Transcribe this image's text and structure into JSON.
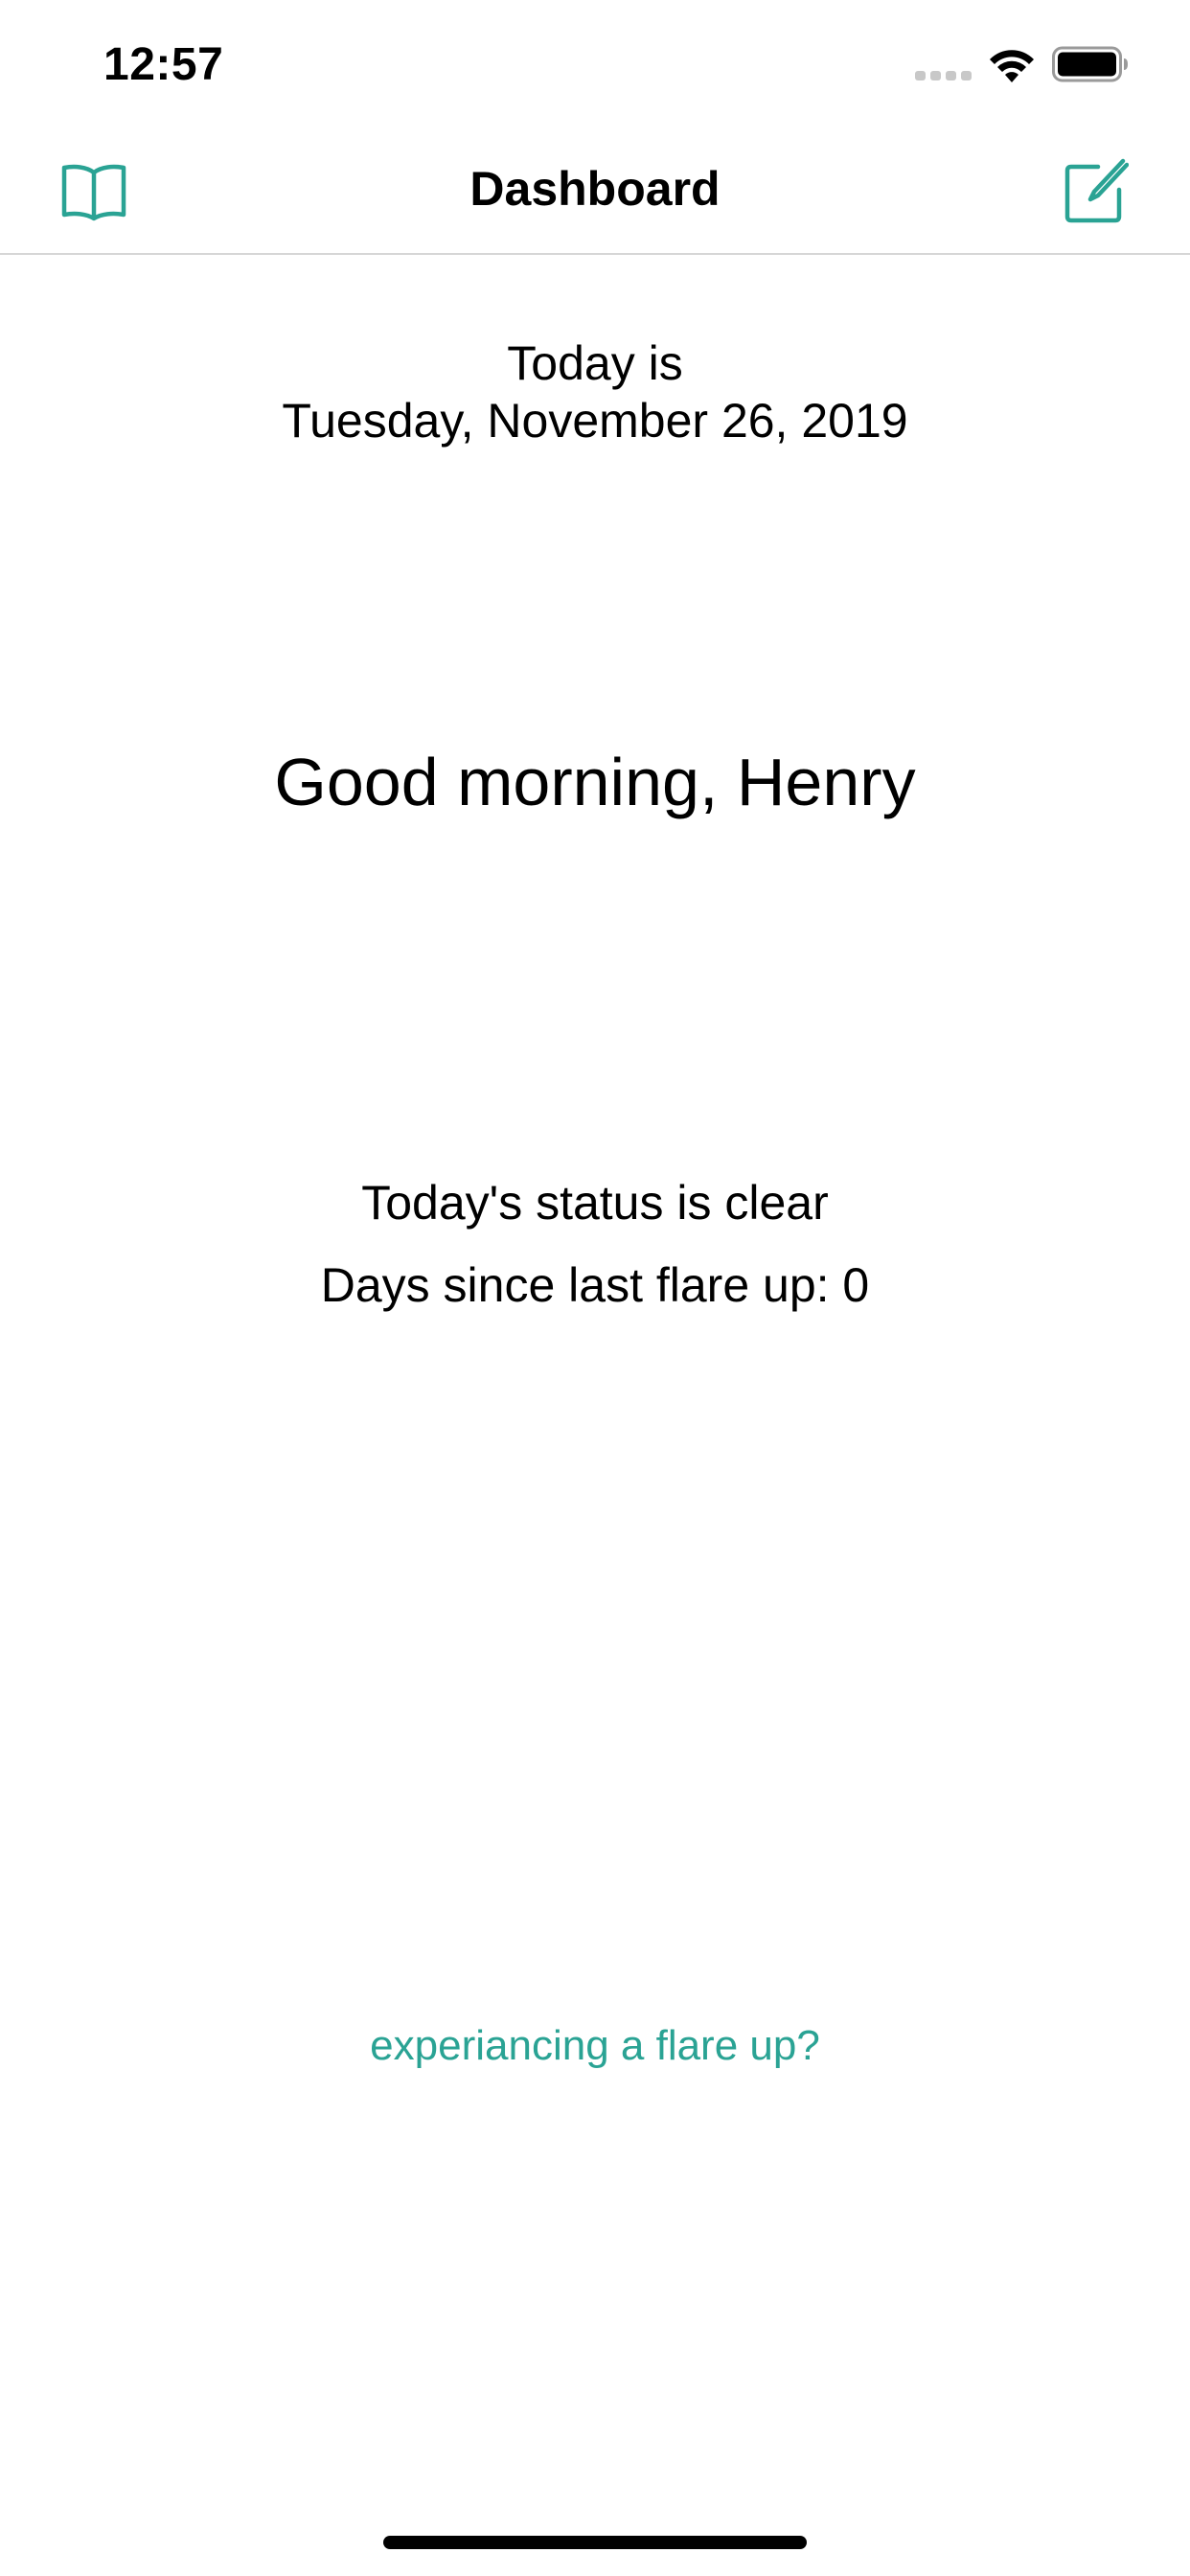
{
  "status_bar": {
    "time": "12:57"
  },
  "nav": {
    "title": "Dashboard",
    "left_icon": "book-icon",
    "right_icon": "compose-icon"
  },
  "main": {
    "today_label": "Today is",
    "today_date": "Tuesday, November 26, 2019",
    "greeting": "Good morning, Henry",
    "status_text": "Today's status is clear",
    "days_since_text": "Days since last flare up: 0",
    "flare_link": "experiancing a flare up?"
  },
  "colors": {
    "accent": "#2aa394",
    "text": "#000000",
    "divider": "#d6d6d6"
  }
}
